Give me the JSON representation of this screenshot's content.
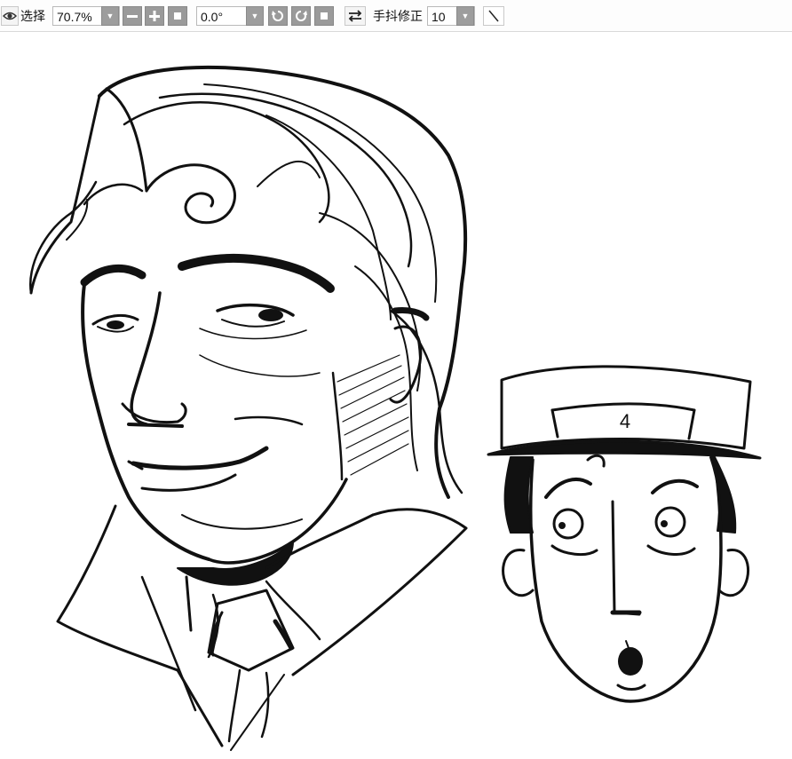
{
  "toolbar": {
    "eye_icon": "eye-icon",
    "select_label": "选择",
    "zoom_value": "70.7%",
    "zoom_dropdown_icon": "chevron-down-icon",
    "zoom_out_icon": "minus-icon",
    "zoom_in_icon": "plus-icon",
    "zoom_reset_icon": "square-icon",
    "rotation_value": "0.0°",
    "rotation_dropdown_icon": "chevron-down-icon",
    "rotate_ccw_icon": "rotate-left-icon",
    "rotate_cw_icon": "rotate-right-icon",
    "rotation_reset_icon": "square-icon",
    "flip_icon": "flip-horizontal-icon",
    "stabilizer_label": "手抖修正",
    "stabilizer_value": "10",
    "stabilizer_dropdown_icon": "chevron-down-icon",
    "line_tool_icon": "diagonal-line-icon"
  },
  "canvas": {
    "cap_number": "4"
  },
  "colors": {
    "toolbar_bg": "#fdfdfd",
    "button_gray": "#9a9a9a",
    "ink": "#111111"
  }
}
